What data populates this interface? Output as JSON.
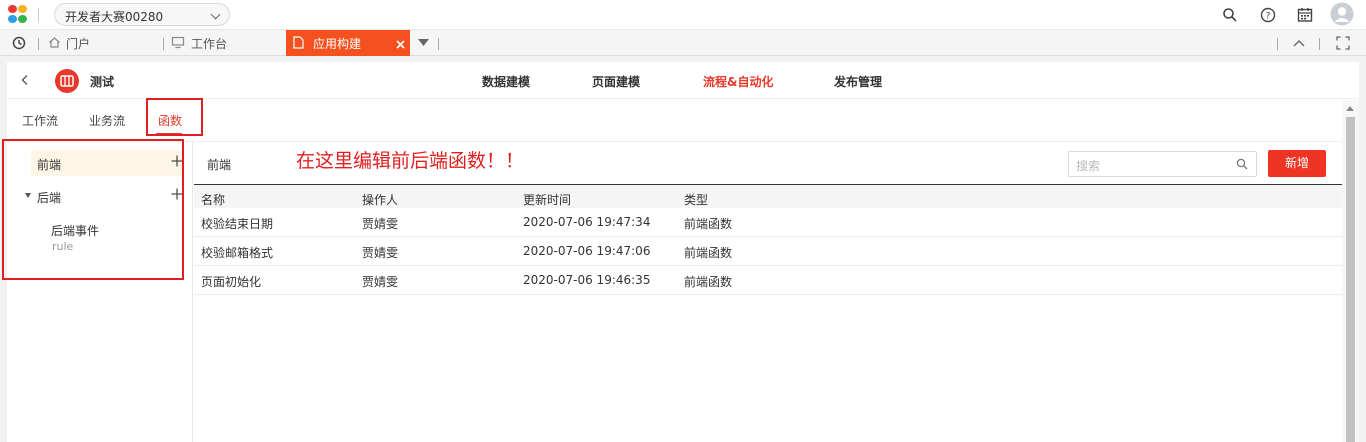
{
  "topbar": {
    "org_name": "开发者大赛00280",
    "logo_colors": [
      "#e83a2e",
      "#f6b21b",
      "#2a9ee8",
      "#34b44a"
    ]
  },
  "tabs": {
    "portal": "门户",
    "workbench": "工作台",
    "app_build": "应用构建"
  },
  "app": {
    "name": "测试",
    "nav": [
      "数据建模",
      "页面建模",
      "流程&自动化",
      "发布管理"
    ],
    "active_nav": "流程&自动化"
  },
  "subtabs": [
    "工作流",
    "业务流",
    "函数"
  ],
  "tree": {
    "frontend": "前端",
    "backend": "后端",
    "child_name": "后端事件",
    "child_sub": "rule"
  },
  "panel": {
    "title": "前端",
    "annotation": "在这里编辑前后端函数！！",
    "search_placeholder": "搜索",
    "new_button": "新增"
  },
  "table": {
    "headers": [
      "名称",
      "操作人",
      "更新时间",
      "类型"
    ],
    "rows": [
      [
        "校验结束日期",
        "贾婧雯",
        "2020-07-06 19:47:34",
        "前端函数"
      ],
      [
        "校验邮箱格式",
        "贾婧雯",
        "2020-07-06 19:47:06",
        "前端函数"
      ],
      [
        "页面初始化",
        "贾婧雯",
        "2020-07-06 19:46:35",
        "前端函数"
      ]
    ]
  },
  "colors": {
    "accent": "#e6392b",
    "annotation": "#e02020",
    "tab_active": "#f4511e"
  }
}
